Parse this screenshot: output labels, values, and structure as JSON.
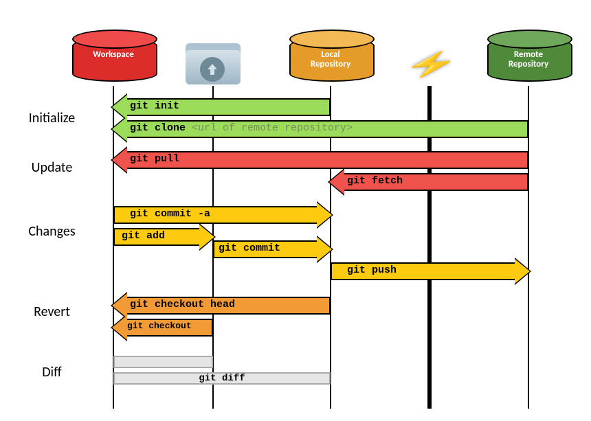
{
  "locations": {
    "workspace": "Workspace",
    "local_repo_line1": "Local",
    "local_repo_line2": "Repository",
    "remote_repo_line1": "Remote",
    "remote_repo_line2": "Repository"
  },
  "rows": {
    "initialize": "Initialize",
    "update": "Update",
    "changes": "Changes",
    "revert": "Revert",
    "diff": "Diff"
  },
  "cmds": {
    "git_init": "git init",
    "git_clone": "git clone ",
    "git_clone_arg": "<url of remote repository>",
    "git_pull": "git pull",
    "git_fetch": "git fetch",
    "git_commit_a": "git commit -a",
    "git_add": "git add",
    "git_commit": "git commit",
    "git_push": "git push",
    "git_checkout_head": "git checkout head",
    "git_checkout": "git checkout",
    "git_diff": "git diff"
  },
  "lanes": {
    "_comment": "x pixel centers of the four lifelines",
    "workspace": 165,
    "index": 310,
    "local": 481,
    "net": 625,
    "remote": 769
  }
}
